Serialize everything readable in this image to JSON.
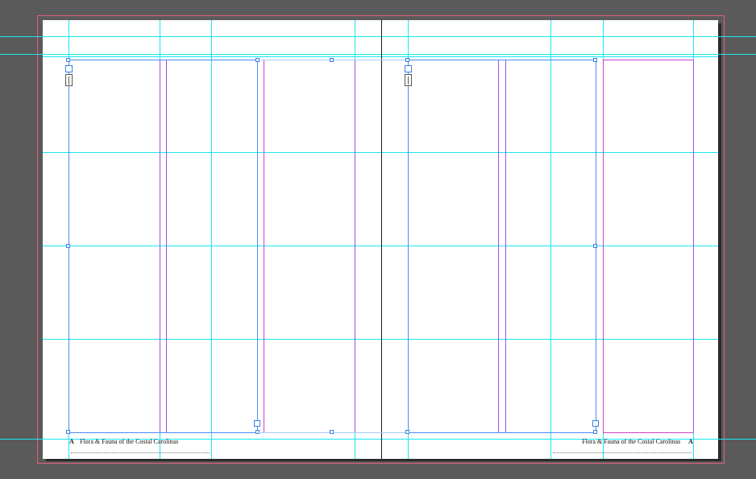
{
  "document": {
    "left_page": {
      "folio": "A",
      "running_footer": "Flora & Fauna of the Costal Carolinas"
    },
    "right_page": {
      "folio": "A",
      "running_footer": "Flora & Fauna of the Costal Carolinas"
    }
  },
  "colors": {
    "pasteboard": "#5a5a5a",
    "page": "#ffffff",
    "bleed": "#e0607a",
    "guide": "#19e6f2",
    "column_guide": "#a14ce8",
    "margin_guide": "#d040c8",
    "frame_selection": "#3a7ee8"
  }
}
